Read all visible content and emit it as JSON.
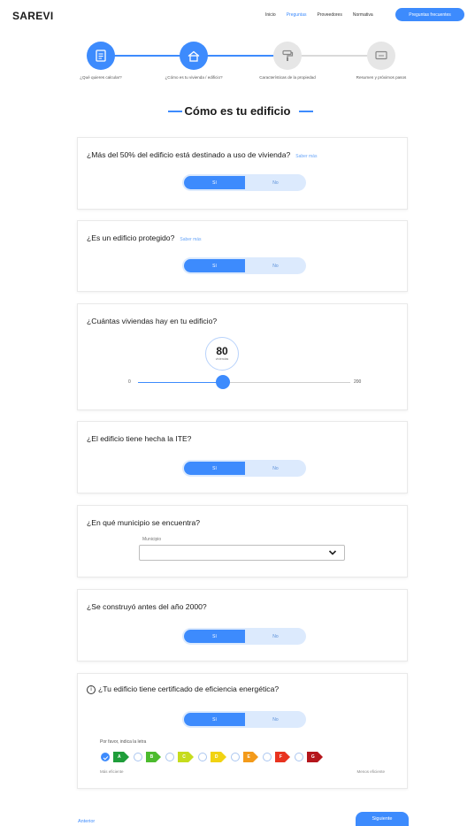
{
  "header": {
    "logo": "SAREVI",
    "nav": [
      "Inicio",
      "Preguntas",
      "Proveedores",
      "Normativa"
    ],
    "cta_label": "Preguntas frecuentes",
    "accent": "#3d8bfd"
  },
  "stepper": {
    "steps": [
      {
        "label": "¿Qué quieres calcular?",
        "icon": "document-icon",
        "done": true
      },
      {
        "label": "¿Cómo es tu vivienda / edificio?",
        "icon": "home-icon",
        "done": true
      },
      {
        "label": "Características de la propiedad",
        "icon": "paint-roller-icon",
        "done": false
      },
      {
        "label": "Resumen y próximos pasos",
        "icon": "screen-icon",
        "done": false
      }
    ]
  },
  "title": "Cómo es tu edificio",
  "cards": {
    "vivienda": {
      "question": "¿Más del 50% del edificio está destinado a uso de vivienda?",
      "more": "Saber más",
      "yes": "Sí",
      "no": "No",
      "selected": "Sí"
    },
    "protegido": {
      "question": "¿Es un edificio protegido?",
      "more": "Saber más",
      "yes": "Sí",
      "no": "No",
      "selected": "Sí"
    },
    "viviendas": {
      "question": "¿Cuántas viviendas hay en tu edificio?",
      "value": "80",
      "unit": "viviendas",
      "min": "0",
      "max": "200",
      "value_num": 80,
      "min_num": 0,
      "max_num": 200
    },
    "ite": {
      "question": "¿El edificio tiene hecha la ITE?",
      "yes": "Sí",
      "no": "No",
      "selected": "Sí"
    },
    "municipio": {
      "question": "¿En qué municipio se encuentra?",
      "select_label": "Municipio",
      "select_value": ""
    },
    "anio": {
      "question": "¿Se construyó antes del año 2000?",
      "yes": "Sí",
      "no": "No",
      "selected": "Sí"
    },
    "energia": {
      "question": "¿Tu edificio tiene certificado de eficiencia energética?",
      "yes": "Sí",
      "no": "No",
      "selected": "Sí",
      "prompt": "Por favor, indica la letra",
      "low_label": "Más eficiente",
      "high_label": "Menos eficiente",
      "letters": [
        {
          "letter": "A",
          "color": "#1f9d3a",
          "checked": true
        },
        {
          "letter": "B",
          "color": "#4cbb2e",
          "checked": false
        },
        {
          "letter": "C",
          "color": "#c6dc1d",
          "checked": false
        },
        {
          "letter": "D",
          "color": "#f1d312",
          "checked": false
        },
        {
          "letter": "E",
          "color": "#f39a1a",
          "checked": false
        },
        {
          "letter": "F",
          "color": "#e8331f",
          "checked": false
        },
        {
          "letter": "G",
          "color": "#b5161c",
          "checked": false
        }
      ]
    }
  },
  "footer": {
    "back": "Anterior",
    "next": "Siguiente"
  }
}
